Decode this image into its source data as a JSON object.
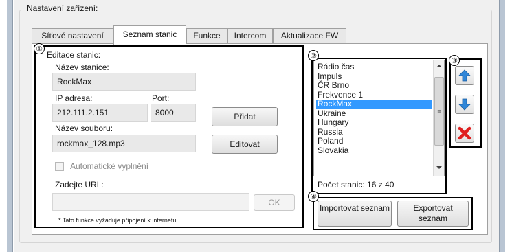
{
  "group": {
    "title": "Nastavení zařízení:"
  },
  "tabs": [
    {
      "label": "Síťové nastavení"
    },
    {
      "label": "Seznam stanic"
    },
    {
      "label": "Funkce"
    },
    {
      "label": "Intercom"
    },
    {
      "label": "Aktualizace FW"
    }
  ],
  "callouts": [
    "①",
    "②",
    "③",
    "④"
  ],
  "editor": {
    "title": "Editace stanic:",
    "name_label": "Název stanice:",
    "name_value": "RockMax",
    "ip_label": "IP adresa:",
    "ip_value": "212.111.2.151",
    "port_label": "Port:",
    "port_value": "8000",
    "add_button": "Přidat",
    "file_label": "Název souboru:",
    "file_value": "rockmax_128.mp3",
    "edit_button": "Editovat",
    "autofill_label": "Automatické vyplnění",
    "url_label": "Zadejte URL:",
    "url_value": "",
    "ok_button": "OK",
    "note": "* Tato funkce vyžaduje připojení k internetu"
  },
  "stations": {
    "items": [
      "Rádio čas",
      "Impuls",
      "ČR Brno",
      "Frekvence 1",
      "RockMax",
      "Ukraine",
      "Hungary",
      "Russia",
      "Poland",
      "Slovakia"
    ],
    "selected": "RockMax",
    "count_text": "Počet stanic: 16 z 40",
    "scroll_marker": "≡"
  },
  "actions": {
    "up": "arrow-up-icon",
    "down": "arrow-down-icon",
    "delete": "delete-x-icon",
    "import_label": "Importovat seznam",
    "export_label": "Exportovat seznam"
  },
  "colors": {
    "selection": "#3399ff",
    "arrow": "#2f86d8",
    "delete": "#e02020"
  }
}
